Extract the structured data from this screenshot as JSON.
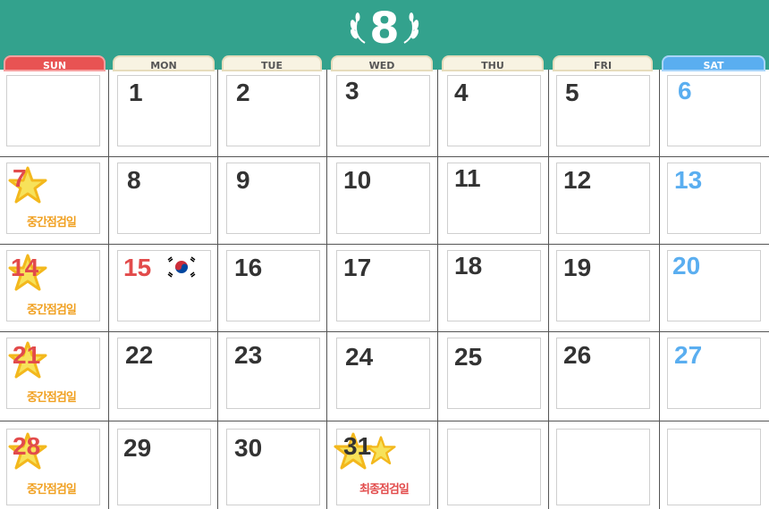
{
  "calendar": {
    "month": "8",
    "weekdays": [
      "SUN",
      "MON",
      "TUE",
      "WED",
      "THU",
      "FRI",
      "SAT"
    ],
    "weeks": [
      [
        "",
        "1",
        "2",
        "3",
        "4",
        "5",
        "6"
      ],
      [
        "7",
        "8",
        "9",
        "10",
        "11",
        "12",
        "13"
      ],
      [
        "14",
        "15",
        "16",
        "17",
        "18",
        "19",
        "20"
      ],
      [
        "21",
        "22",
        "23",
        "24",
        "25",
        "26",
        "27"
      ],
      [
        "28",
        "29",
        "30",
        "31",
        "",
        "",
        ""
      ]
    ],
    "notes": {
      "midterm": "중간점검일",
      "final": "최종점검일"
    }
  },
  "colors": {
    "header": "#33a28d",
    "sunday": "#e24b4b",
    "saturday": "#5aaef0",
    "note": "#f0a020",
    "star": "#f7c825"
  }
}
